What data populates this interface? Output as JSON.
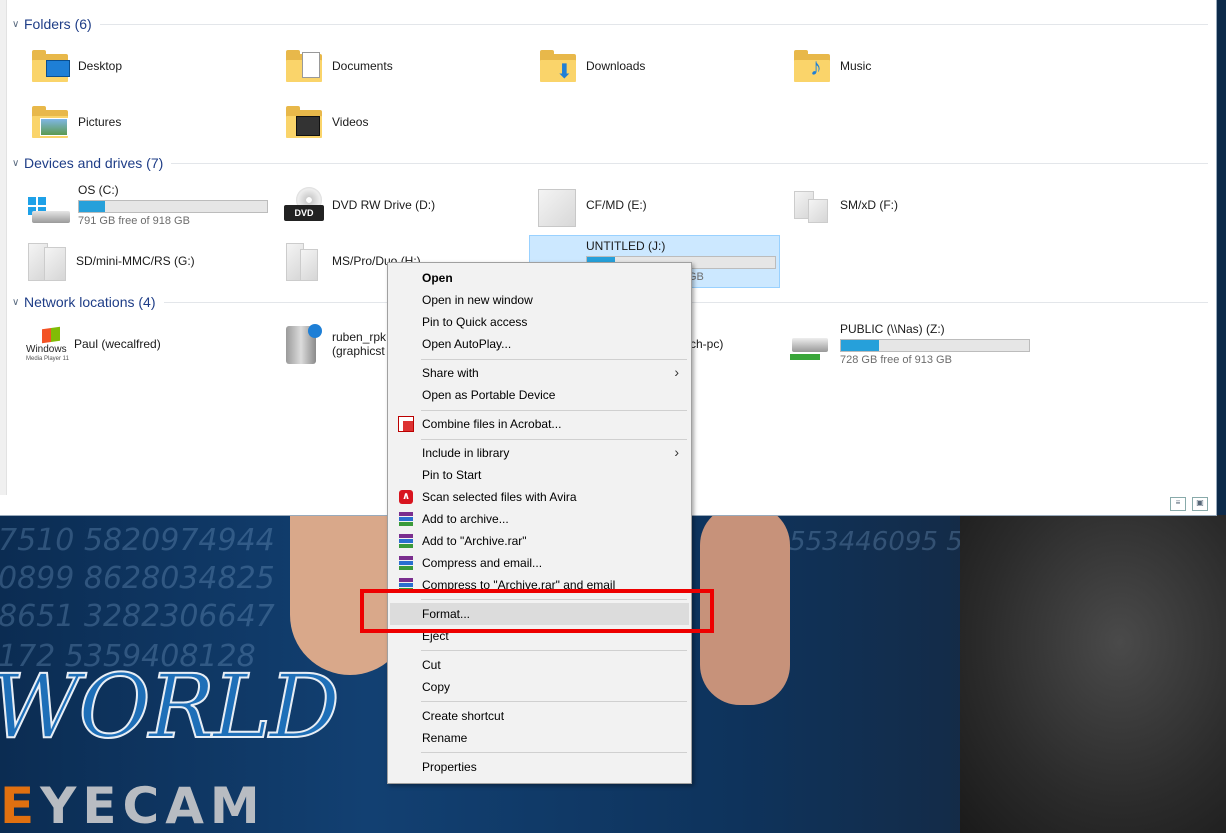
{
  "groups": {
    "folders": "Folders (6)",
    "devices": "Devices and drives (7)",
    "network": "Network locations (4)"
  },
  "folders": [
    {
      "label": "Desktop",
      "icon": "desktop-folder-icon"
    },
    {
      "label": "Documents",
      "icon": "documents-folder-icon"
    },
    {
      "label": "Downloads",
      "icon": "downloads-folder-icon"
    },
    {
      "label": "Music",
      "icon": "music-folder-icon"
    },
    {
      "label": "Pictures",
      "icon": "pictures-folder-icon"
    },
    {
      "label": "Videos",
      "icon": "videos-folder-icon"
    }
  ],
  "drives": [
    {
      "label": "OS (C:)",
      "sub": "791 GB free of 918 GB",
      "used_fraction": 0.14
    },
    {
      "label": "DVD RW Drive (D:)",
      "badge": "DVD"
    },
    {
      "label": "CF/MD (E:)"
    },
    {
      "label": "SM/xD (F:)"
    },
    {
      "label": "SD/mini-MMC/RS (G:)"
    },
    {
      "label": "MS/Pro/Duo (H:)"
    },
    {
      "label": "UNTITLED (J:)",
      "sub_visible": "GB",
      "used_fraction": 0.15
    }
  ],
  "network": [
    {
      "label": "Paul (wecalfred)",
      "logo": "Windows",
      "logo_sub": "Media Player 11"
    },
    {
      "label": "ruben_rpk",
      "sub": "(graphicst"
    },
    {
      "label": "ch-pc)"
    },
    {
      "label": "PUBLIC (\\\\Nas) (Z:)",
      "sub": "728 GB free of 913 GB",
      "used_fraction": 0.2
    }
  ],
  "menu": {
    "open": "Open",
    "open_new_window": "Open in new window",
    "pin_quick": "Pin to Quick access",
    "open_autoplay": "Open AutoPlay...",
    "share_with": "Share with",
    "open_portable": "Open as Portable Device",
    "combine_acrobat": "Combine files in Acrobat...",
    "include_library": "Include in library",
    "pin_start": "Pin to Start",
    "scan_avira": "Scan selected files with Avira",
    "add_archive": "Add to archive...",
    "add_archive_rar": "Add to \"Archive.rar\"",
    "compress_email": "Compress and email...",
    "compress_rar_email": "Compress to \"Archive.rar\" and email",
    "format": "Format...",
    "eject": "Eject",
    "cut": "Cut",
    "copy": "Copy",
    "create_shortcut": "Create shortcut",
    "rename": "Rename",
    "properties": "Properties"
  },
  "wallpaper": {
    "digits": [
      "7510 5820974944",
      "0899 8628034825",
      "8651 3282306647",
      "172 5359408128",
      "09553446095 5058223172 5359408"
    ],
    "logo_world": "WORLD",
    "logo_e": "E",
    "logo_rest": "YECAM"
  },
  "colors": {
    "accent": "#26a0da",
    "group_title": "#1e3d87",
    "highlight": "#ee0000",
    "selection": "#cce8ff"
  }
}
